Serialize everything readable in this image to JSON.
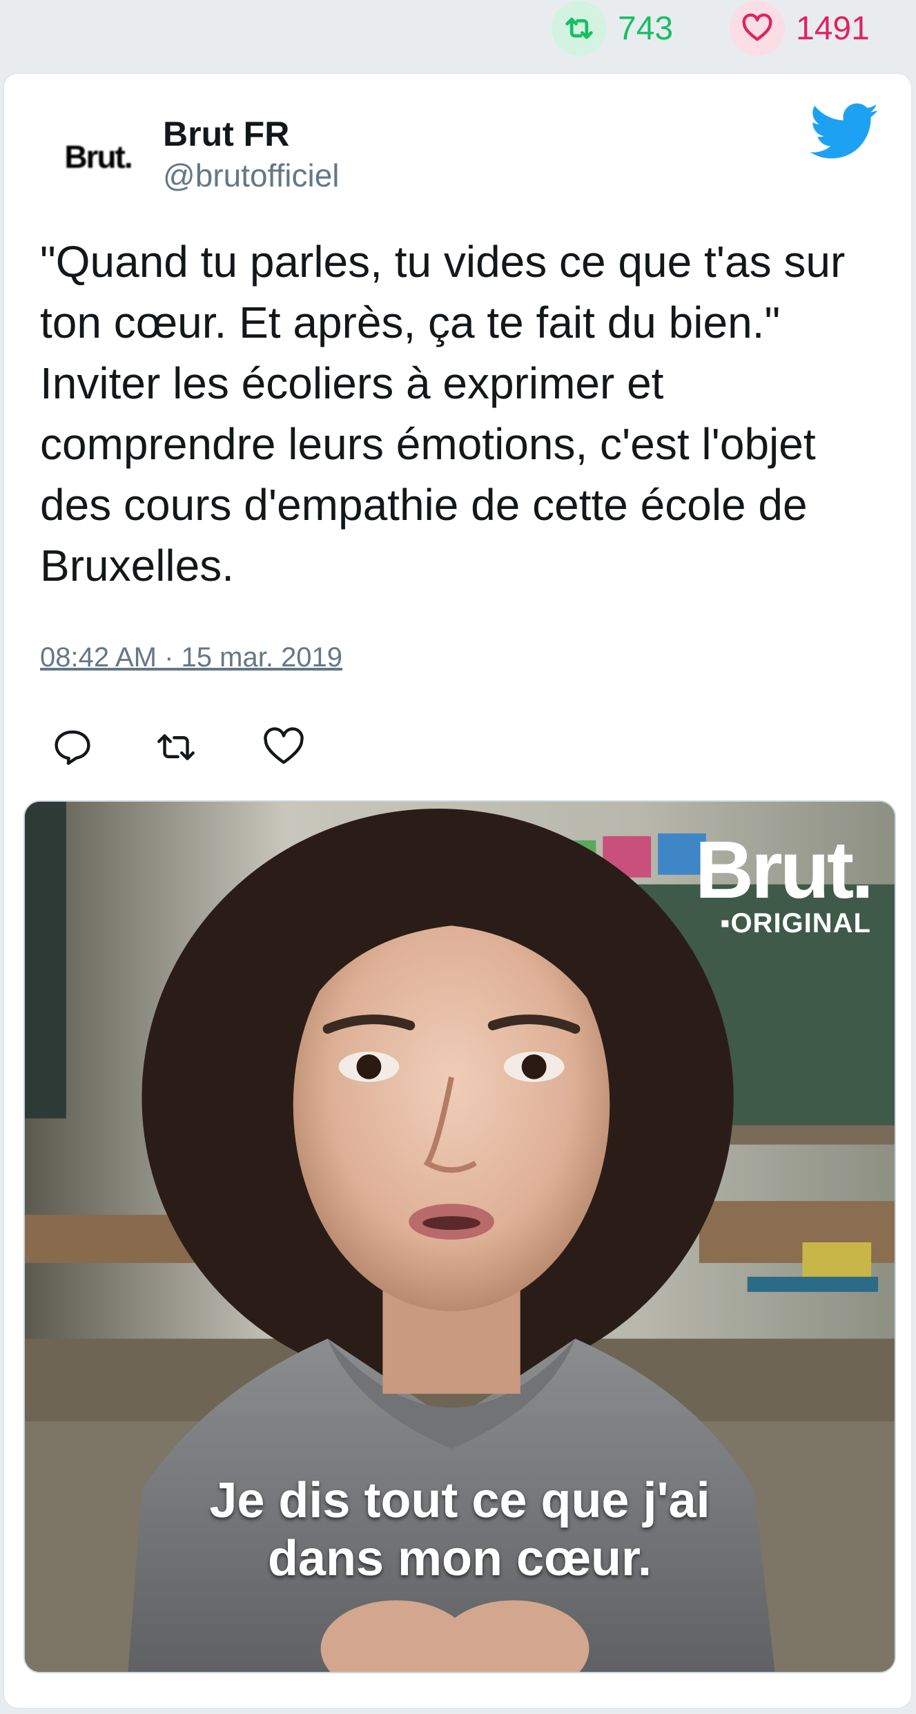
{
  "stats": {
    "retweets": "743",
    "likes": "1491",
    "retweet_icon": "retweet-icon",
    "like_icon": "heart-icon"
  },
  "tweet": {
    "avatar_text": "Brut.",
    "author_name": "Brut FR",
    "author_handle": "@brutofficiel",
    "text_lines": [
      "\"Quand tu parles, tu vides ce que t'as sur",
      "ton cœur. Et après, ça te fait du bien.\"",
      "Inviter les écoliers à exprimer et",
      "comprendre leurs émotions, c'est l'objet",
      "des cours d'empathie de cette école de",
      "Bruxelles."
    ],
    "timestamp": "08:42 AM · 15 mar. 2019",
    "actions": [
      "reply-icon",
      "retweet-icon",
      "heart-icon"
    ]
  },
  "media": {
    "logo_main": "Brut.",
    "logo_sub": "▪ORIGINAL",
    "subtitle_lines": [
      "Je dis tout ce que j'ai",
      "dans mon cœur."
    ]
  },
  "colors": {
    "retweet_green": "#17bf63",
    "like_red": "#e0245e",
    "twitter_blue": "#1da1f2",
    "secondary_text": "#657786"
  }
}
